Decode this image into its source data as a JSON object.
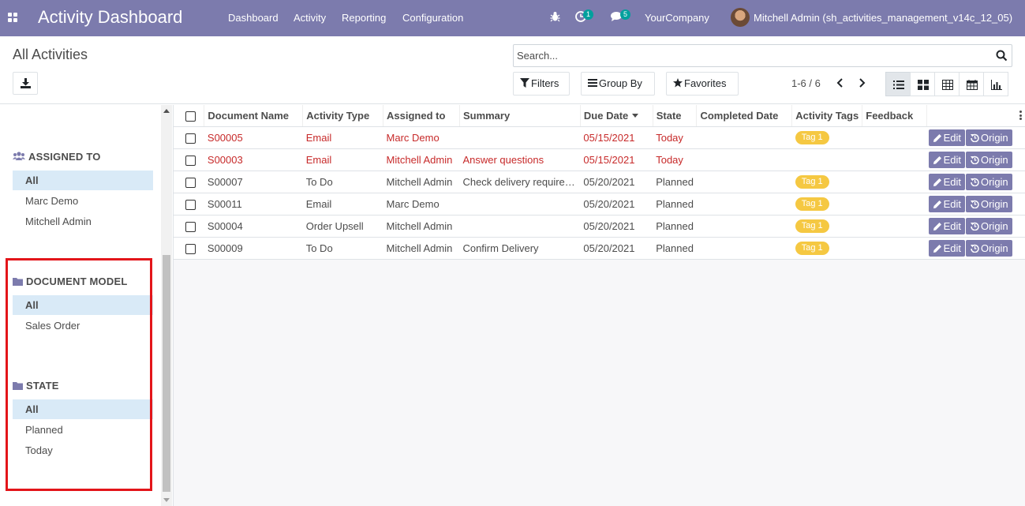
{
  "navbar": {
    "app_title": "Activity Dashboard",
    "menus": [
      "Dashboard",
      "Activity",
      "Reporting",
      "Configuration"
    ],
    "activity_count": "1",
    "message_count": "5",
    "company": "YourCompany",
    "user": "Mitchell Admin (sh_activities_management_v14c_12_05)",
    "brand_color": "#7c7bad"
  },
  "control_panel": {
    "title": "All Activities",
    "search_placeholder": "Search...",
    "filters_label": "Filters",
    "groupby_label": "Group By",
    "favorites_label": "Favorites",
    "pager": "1-6 / 6"
  },
  "sidebar": {
    "sections": [
      {
        "title": "ASSIGNED TO",
        "icon": "users-icon",
        "items": [
          {
            "label": "All",
            "selected": true
          },
          {
            "label": "Marc Demo",
            "selected": false
          },
          {
            "label": "Mitchell Admin",
            "selected": false
          }
        ]
      },
      {
        "title": "DOCUMENT MODEL",
        "icon": "folder-icon",
        "items": [
          {
            "label": "All",
            "selected": true
          },
          {
            "label": "Sales Order",
            "selected": false
          }
        ]
      },
      {
        "title": "STATE",
        "icon": "folder-icon",
        "items": [
          {
            "label": "All",
            "selected": true
          },
          {
            "label": "Planned",
            "selected": false
          },
          {
            "label": "Today",
            "selected": false
          }
        ]
      }
    ],
    "highlight_color": "#e3151a"
  },
  "table": {
    "columns": [
      "Document Name",
      "Activity Type",
      "Assigned to",
      "Summary",
      "Due Date",
      "State",
      "Completed Date",
      "Activity Tags",
      "Feedback"
    ],
    "edit_label": "Edit",
    "origin_label": "Origin",
    "rows": [
      {
        "doc": "S00005",
        "type": "Email",
        "assigned": "Marc Demo",
        "summary": "",
        "due": "05/15/2021",
        "state": "Today",
        "completed": "",
        "tag": "Tag 1",
        "feedback": "",
        "late": true
      },
      {
        "doc": "S00003",
        "type": "Email",
        "assigned": "Mitchell Admin",
        "summary": "Answer questions",
        "due": "05/15/2021",
        "state": "Today",
        "completed": "",
        "tag": "",
        "feedback": "",
        "late": true
      },
      {
        "doc": "S00007",
        "type": "To Do",
        "assigned": "Mitchell Admin",
        "summary": "Check delivery require…",
        "due": "05/20/2021",
        "state": "Planned",
        "completed": "",
        "tag": "Tag 1",
        "feedback": "",
        "late": false
      },
      {
        "doc": "S00011",
        "type": "Email",
        "assigned": "Marc Demo",
        "summary": "",
        "due": "05/20/2021",
        "state": "Planned",
        "completed": "",
        "tag": "Tag 1",
        "feedback": "",
        "late": false
      },
      {
        "doc": "S00004",
        "type": "Order Upsell",
        "assigned": "Mitchell Admin",
        "summary": "",
        "due": "05/20/2021",
        "state": "Planned",
        "completed": "",
        "tag": "Tag 1",
        "feedback": "",
        "late": false
      },
      {
        "doc": "S00009",
        "type": "To Do",
        "assigned": "Mitchell Admin",
        "summary": "Confirm Delivery",
        "due": "05/20/2021",
        "state": "Planned",
        "completed": "",
        "tag": "Tag 1",
        "feedback": "",
        "late": false
      }
    ]
  }
}
